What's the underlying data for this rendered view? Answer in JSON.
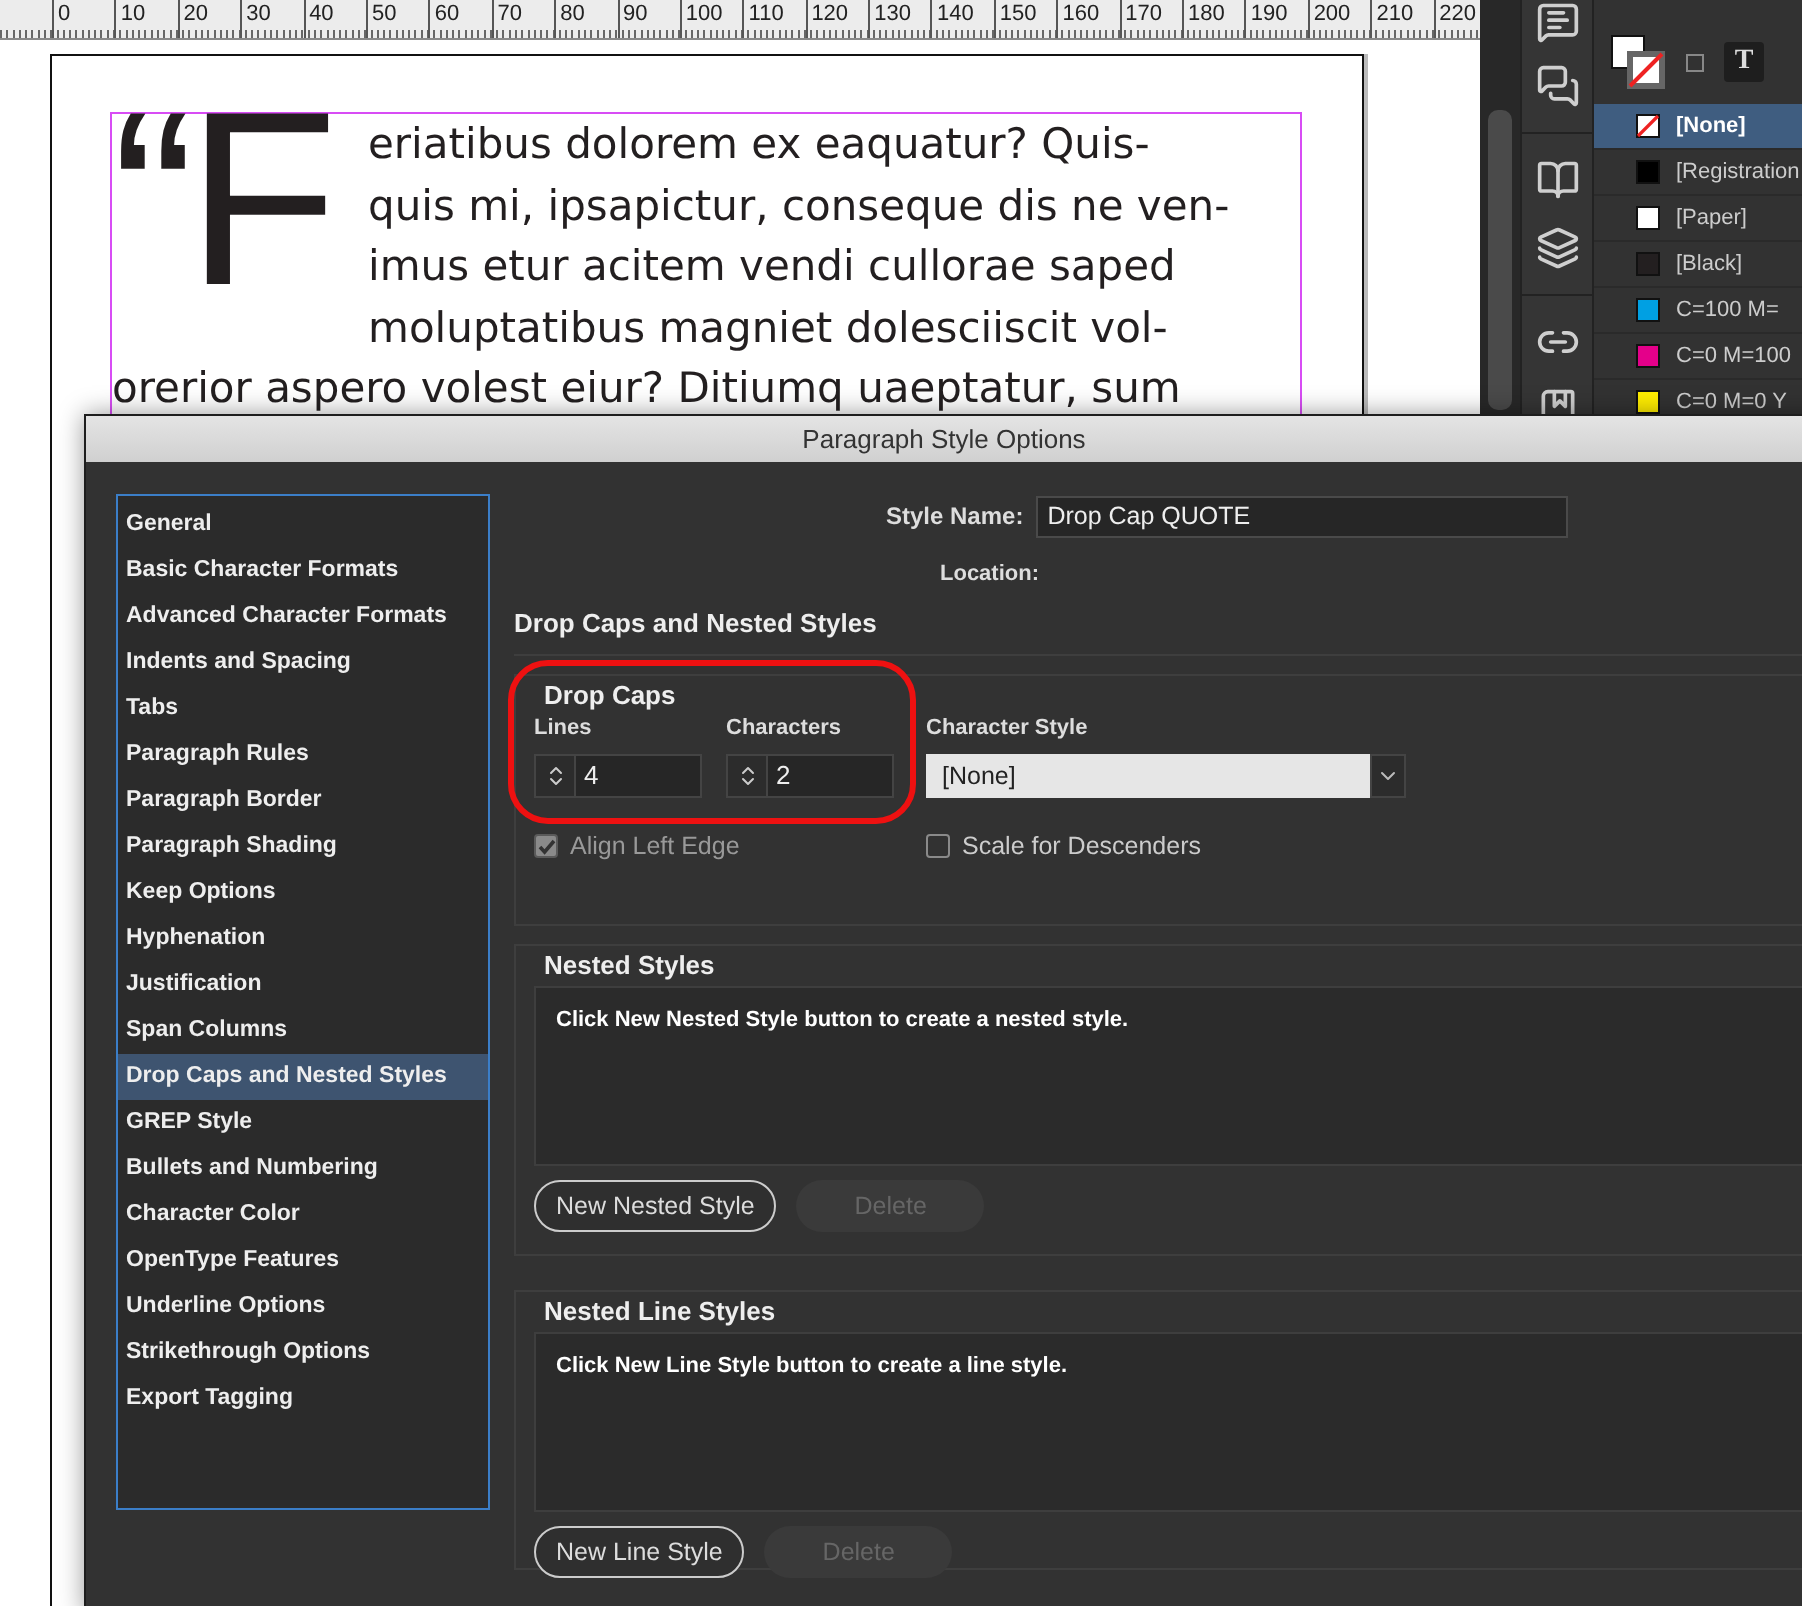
{
  "ruler": {
    "ticks": [
      "0",
      "10",
      "20",
      "30",
      "40",
      "50",
      "60",
      "70",
      "80",
      "90",
      "100",
      "110",
      "120",
      "130",
      "140",
      "150",
      "160",
      "170",
      "180",
      "190",
      "200",
      "210",
      "220"
    ]
  },
  "document": {
    "drop_cap": "“F",
    "lines": [
      "eriatibus dolorem ex eaquatur? Quis-",
      "quis mi, ipsapictur, conseque dis ne ven-",
      "imus etur acitem vendi cullorae saped",
      "moluptatibus magniet dolesciiscit vol-"
    ],
    "full_line": "orerior aspero volest eiur? Ditiumq uaeptatur, sum"
  },
  "swatches": [
    {
      "name": "[None]",
      "kind": "none",
      "selected": true
    },
    {
      "name": "[Registration",
      "color": "#000000",
      "selected": false
    },
    {
      "name": "[Paper]",
      "color": "#ffffff",
      "selected": false
    },
    {
      "name": "[Black]",
      "color": "#231f20",
      "selected": false
    },
    {
      "name": "C=100 M=",
      "color": "#00a0e3",
      "selected": false
    },
    {
      "name": "C=0 M=100",
      "color": "#e4008a",
      "selected": false
    },
    {
      "name": "C=0 M=0 Y",
      "color": "#ffed00",
      "selected": false
    }
  ],
  "swatch_toolbar": {
    "text_button": "T"
  },
  "dialog": {
    "title": "Paragraph Style Options",
    "sidebar": [
      {
        "label": "General",
        "selected": false
      },
      {
        "label": "Basic Character Formats",
        "selected": false
      },
      {
        "label": "Advanced Character Formats",
        "selected": false
      },
      {
        "label": "Indents and Spacing",
        "selected": false
      },
      {
        "label": "Tabs",
        "selected": false
      },
      {
        "label": "Paragraph Rules",
        "selected": false
      },
      {
        "label": "Paragraph Border",
        "selected": false
      },
      {
        "label": "Paragraph Shading",
        "selected": false
      },
      {
        "label": "Keep Options",
        "selected": false
      },
      {
        "label": "Hyphenation",
        "selected": false
      },
      {
        "label": "Justification",
        "selected": false
      },
      {
        "label": "Span Columns",
        "selected": false
      },
      {
        "label": "Drop Caps and Nested Styles",
        "selected": true
      },
      {
        "label": "GREP Style",
        "selected": false
      },
      {
        "label": "Bullets and Numbering",
        "selected": false
      },
      {
        "label": "Character Color",
        "selected": false
      },
      {
        "label": "OpenType Features",
        "selected": false
      },
      {
        "label": "Underline Options",
        "selected": false
      },
      {
        "label": "Strikethrough Options",
        "selected": false
      },
      {
        "label": "Export Tagging",
        "selected": false
      }
    ],
    "style_name": {
      "label": "Style Name:",
      "value": "Drop Cap QUOTE"
    },
    "location": {
      "label": "Location:"
    },
    "section_title": "Drop Caps and Nested Styles",
    "drop_caps": {
      "title": "Drop Caps",
      "lines": {
        "label": "Lines",
        "value": "4"
      },
      "characters": {
        "label": "Characters",
        "value": "2"
      },
      "character_style": {
        "label": "Character Style",
        "value": "[None]"
      },
      "align_left_edge": {
        "label": "Align Left Edge",
        "checked": true,
        "disabled": true
      },
      "scale_for_descenders": {
        "label": "Scale for Descenders",
        "checked": false,
        "disabled": false
      }
    },
    "nested_styles": {
      "title": "Nested Styles",
      "hint": "Click New Nested Style button to create a nested style.",
      "new_button": {
        "label": "New Nested Style",
        "disabled": false
      },
      "delete_button": {
        "label": "Delete",
        "disabled": true
      }
    },
    "nested_line_styles": {
      "title": "Nested Line Styles",
      "hint": "Click New Line Style button to create a line style.",
      "new_button": {
        "label": "New Line Style",
        "disabled": false
      },
      "delete_button": {
        "label": "Delete",
        "disabled": true
      }
    }
  }
}
